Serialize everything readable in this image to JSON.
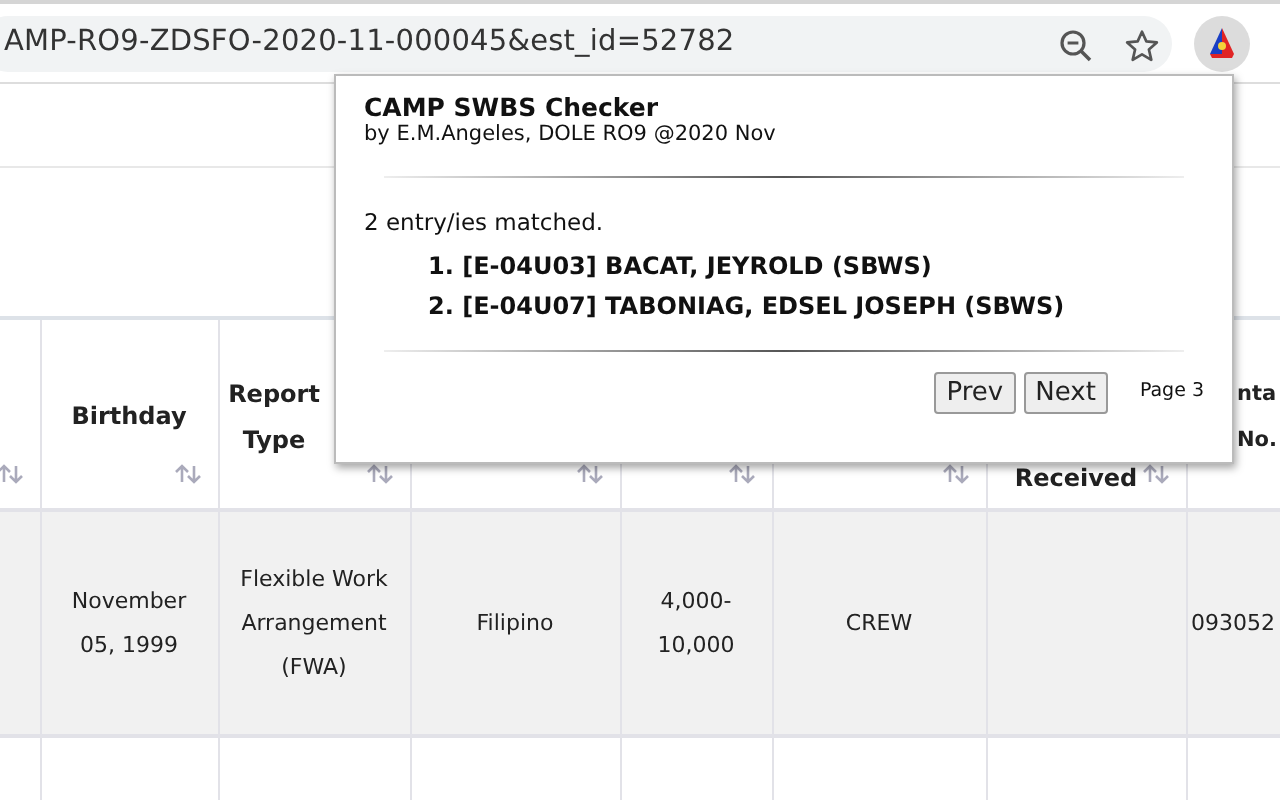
{
  "browser": {
    "url": "AMP-RO9-ZDSFO-2020-11-000045&est_id=52782"
  },
  "table": {
    "columns": [
      {
        "sortable": true
      },
      {
        "lines": [
          "Birthday"
        ],
        "sortable": true
      },
      {
        "lines": [
          "Report",
          "Type"
        ],
        "sortable": true
      },
      {
        "sortable": true
      },
      {
        "sortable": true
      },
      {
        "sortable": true
      },
      {
        "lines": [
          "Received"
        ],
        "sortable": true
      },
      {
        "lines": [
          "nta",
          "No."
        ],
        "sortable": false
      }
    ],
    "rows": [
      [
        "",
        "November 05, 1999",
        "Flexible Work Arrangement (FWA)",
        "Filipino",
        "4,000-10,000",
        "CREW",
        "",
        "093052"
      ],
      [
        "",
        "",
        "",
        "",
        "",
        "",
        "",
        ""
      ]
    ]
  },
  "popup": {
    "title": "CAMP SWBS Checker",
    "byline": "by E.M.Angeles, DOLE RO9 @2020 Nov",
    "summary": "2 entry/ies matched.",
    "matches": [
      {
        "number": "1.",
        "text": "[E-04U03] BACAT, JEYROLD (SBWS)"
      },
      {
        "number": "2.",
        "text": "[E-04U07] TABONIAG, EDSEL JOSEPH (SBWS)"
      }
    ],
    "buttons": [
      "Prev",
      "Next"
    ],
    "page": "Page 3"
  }
}
